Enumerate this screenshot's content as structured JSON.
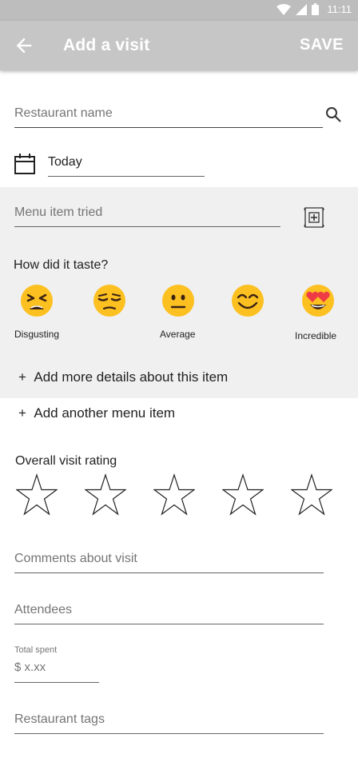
{
  "status_bar": {
    "time": "11:11",
    "icons": [
      "wifi-icon",
      "signal-icon",
      "battery-icon"
    ]
  },
  "app_bar": {
    "title": "Add a visit",
    "save_label": "SAVE",
    "back_icon": "arrow-back-icon"
  },
  "form": {
    "restaurant_name_placeholder": "Restaurant name",
    "date_value": "Today",
    "menu_item_placeholder": "Menu item tried",
    "taste_question": "How did it taste?",
    "taste_scale": [
      {
        "icon": "disgusting-face-icon"
      },
      {
        "icon": "unamused-face-icon"
      },
      {
        "icon": "neutral-face-icon"
      },
      {
        "icon": "smiling-face-icon"
      },
      {
        "icon": "heart-eyes-face-icon"
      }
    ],
    "taste_labels": {
      "low": "Disgusting",
      "mid": "Average",
      "high": "Incredible"
    },
    "add_details_label": "Add more details about this item",
    "add_menu_item_label": "Add another menu item",
    "overall_rating_label": "Overall visit rating",
    "overall_rating_value": 0,
    "overall_rating_max": 5,
    "comments_placeholder": "Comments about visit",
    "attendees_placeholder": "Attendees",
    "total_spent_label": "Total spent",
    "total_spent_placeholder": "$ x.xx",
    "tags_placeholder": "Restaurant tags"
  },
  "colors": {
    "status_bar": "#bdbdbd",
    "app_bar": "#c6c6c6",
    "panel": "#f0f0f0",
    "emoji_yellow": "#fcc021",
    "heart": "#ef3b46",
    "hint_text": "#757575"
  }
}
